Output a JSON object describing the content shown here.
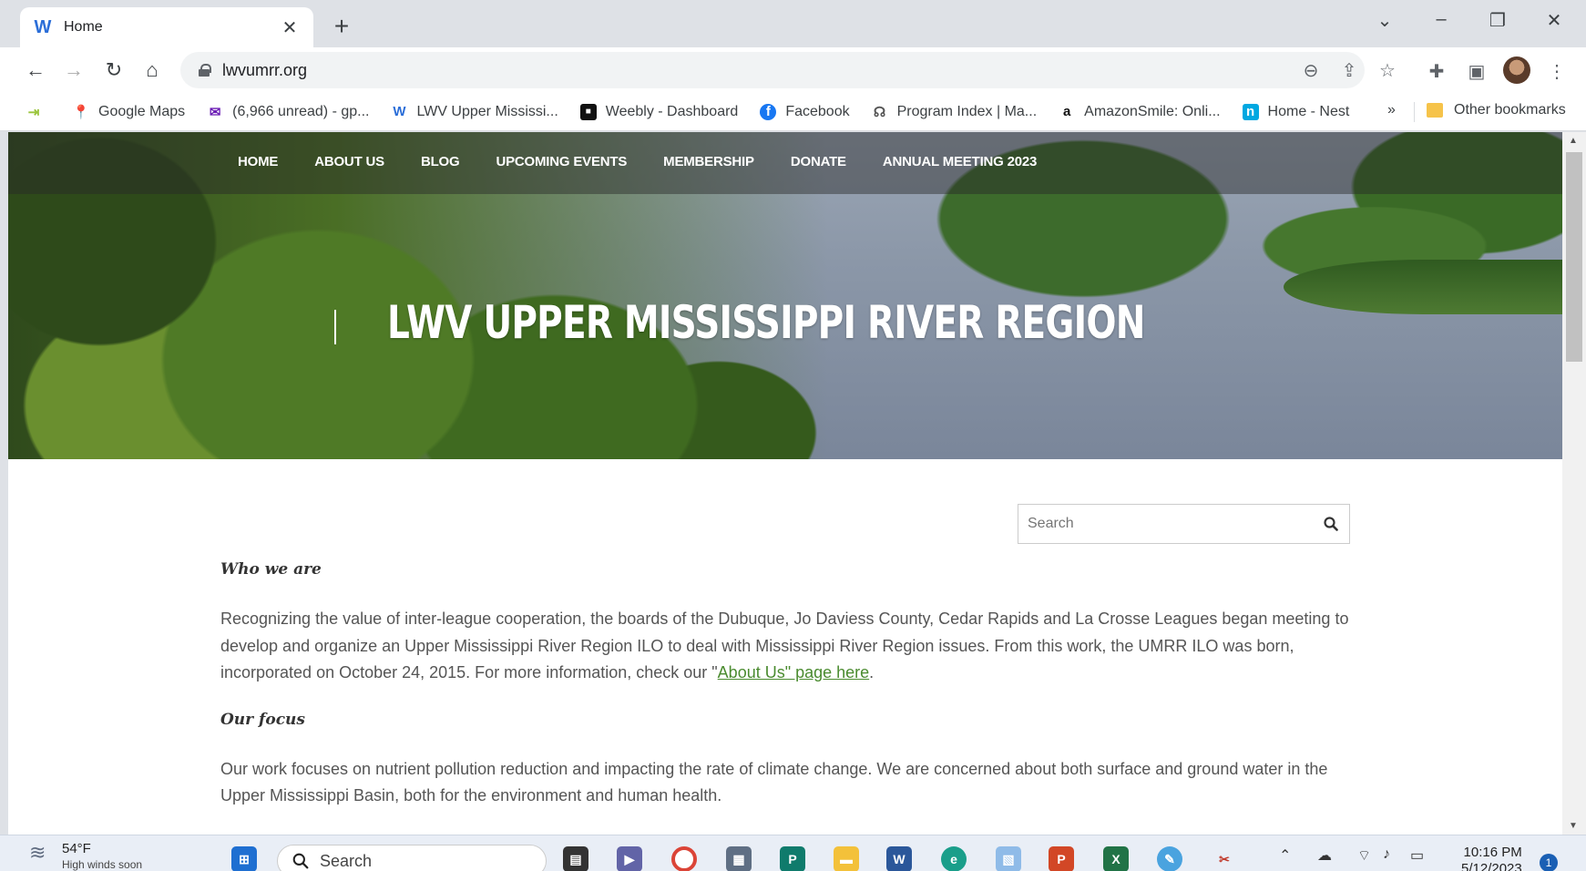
{
  "browser": {
    "tab": {
      "title": "Home",
      "favicon": "weebly-icon"
    },
    "address": {
      "url": "lwvumrr.org"
    },
    "bookmarks": [
      {
        "label": "",
        "icon": "bookmark-arrow-icon"
      },
      {
        "label": "Google Maps",
        "icon": "maps-pin-icon"
      },
      {
        "label": "(6,966 unread) - gp...",
        "icon": "mail-icon"
      },
      {
        "label": "LWV Upper Mississi...",
        "icon": "weebly-icon"
      },
      {
        "label": "Weebly - Dashboard",
        "icon": "square-logo-icon"
      },
      {
        "label": "Facebook",
        "icon": "facebook-icon"
      },
      {
        "label": "Program Index | Ma...",
        "icon": "program-icon"
      },
      {
        "label": "AmazonSmile: Onli...",
        "icon": "amazon-icon"
      },
      {
        "label": "Home - Nest",
        "icon": "nest-icon"
      }
    ],
    "more_bookmarks": "»",
    "other_bookmarks": "Other bookmarks"
  },
  "site": {
    "nav": [
      "HOME",
      "ABOUT US",
      "BLOG",
      "UPCOMING EVENTS",
      "MEMBERSHIP",
      "DONATE",
      "ANNUAL MEETING 2023"
    ],
    "title": "LWV UPPER MISSISSIPPI RIVER REGION",
    "search_placeholder": "Search",
    "sections": {
      "who_heading": "Who we are",
      "who_text_1": "Recognizing the value of inter-league cooperation, the boards of the Dubuque, Jo Daviess County, Cedar Rapids and La Crosse Leagues began meeting to develop and organize an Upper Mississippi River Region ILO to deal with Mississippi River Region issues.  From this work, the UMRR ILO was born, incorporated on October 24, 2015.  For more information, check our \"",
      "who_link": "About Us\" page here",
      "who_text_2": ".",
      "focus_heading": "Our focus",
      "focus_text": "Our work focuses on nutrient pollution reduction and impacting the rate of climate change.  We are concerned about both surface and ground water in the Upper Mississippi Basin, both for the environment and human health."
    }
  },
  "taskbar": {
    "weather_temp": "54°F",
    "weather_desc": "High winds soon",
    "search_label": "Search",
    "time": "10:16 PM",
    "date": "5/12/2023",
    "notifications": "1"
  },
  "colors": {
    "link": "#4a8b2f",
    "tab_strip": "#dee1e6",
    "nav_overlay": "rgba(40,40,40,0.45)"
  }
}
